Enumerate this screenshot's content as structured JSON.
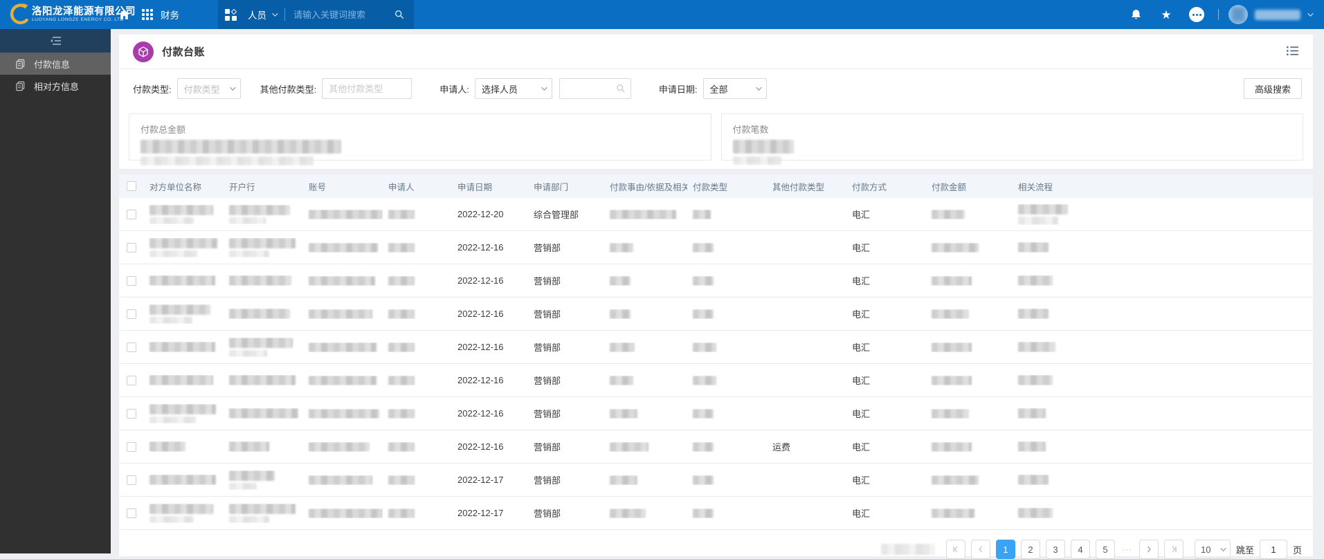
{
  "nav": {
    "company_cn": "洛阳龙泽能源有限公司",
    "company_en": "LUOYANG LONGZE ENERGY CO. LTD",
    "app_label": "财务",
    "org_label": "人员",
    "search_placeholder": "请输入关键词搜索"
  },
  "sidebar": {
    "items": [
      {
        "label": "付款信息",
        "active": true
      },
      {
        "label": "相对方信息",
        "active": false
      }
    ]
  },
  "page": {
    "title": "付款台账",
    "advanced_search_label": "高级搜索"
  },
  "filters": {
    "payment_type_label": "付款类型:",
    "payment_type_placeholder": "付款类型",
    "other_type_label": "其他付款类型:",
    "other_type_placeholder": "其他付款类型",
    "applicant_label": "申请人:",
    "applicant_value": "选择人员",
    "date_label": "申请日期:",
    "date_value": "全部"
  },
  "summary": {
    "total_amount_label": "付款总金额",
    "count_label": "付款笔数"
  },
  "table": {
    "columns": [
      "对方单位名称",
      "开户行",
      "账号",
      "申请人",
      "申请日期",
      "申请部门",
      "付款事由/依据及相关...",
      "付款类型",
      "其他付款类型",
      "付款方式",
      "付款金额",
      "相关流程"
    ],
    "rows": [
      {
        "apply_date": "2022-12-20",
        "department": "综合管理部",
        "other_type": "",
        "method": "电汇"
      },
      {
        "apply_date": "2022-12-16",
        "department": "营销部",
        "other_type": "",
        "method": "电汇"
      },
      {
        "apply_date": "2022-12-16",
        "department": "营销部",
        "other_type": "",
        "method": "电汇"
      },
      {
        "apply_date": "2022-12-16",
        "department": "营销部",
        "other_type": "",
        "method": "电汇"
      },
      {
        "apply_date": "2022-12-16",
        "department": "营销部",
        "other_type": "",
        "method": "电汇"
      },
      {
        "apply_date": "2022-12-16",
        "department": "营销部",
        "other_type": "",
        "method": "电汇"
      },
      {
        "apply_date": "2022-12-16",
        "department": "营销部",
        "other_type": "",
        "method": "电汇"
      },
      {
        "apply_date": "2022-12-16",
        "department": "营销部",
        "other_type": "运费",
        "method": "电汇"
      },
      {
        "apply_date": "2022-12-17",
        "department": "营销部",
        "other_type": "",
        "method": "电汇"
      },
      {
        "apply_date": "2022-12-17",
        "department": "营销部",
        "other_type": "",
        "method": "电汇"
      }
    ]
  },
  "pagination": {
    "pages": [
      "1",
      "2",
      "3",
      "4",
      "5"
    ],
    "active_page": "1",
    "ellipsis": "···",
    "page_size": "10",
    "jump_label": "跳至",
    "jump_value": "1",
    "page_unit": "页"
  }
}
